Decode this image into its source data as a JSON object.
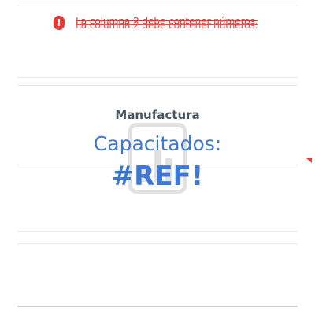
{
  "error": {
    "message": "La columna 2 debe contener números.",
    "icon": "error-icon",
    "color": "#e53935"
  },
  "tile": {
    "subtitle": "Manufactura",
    "label": "Capacitados:",
    "value": "#REF!",
    "accent_color": "#3c78d8"
  },
  "watermark": {
    "icon": "bar-chart-icon"
  }
}
